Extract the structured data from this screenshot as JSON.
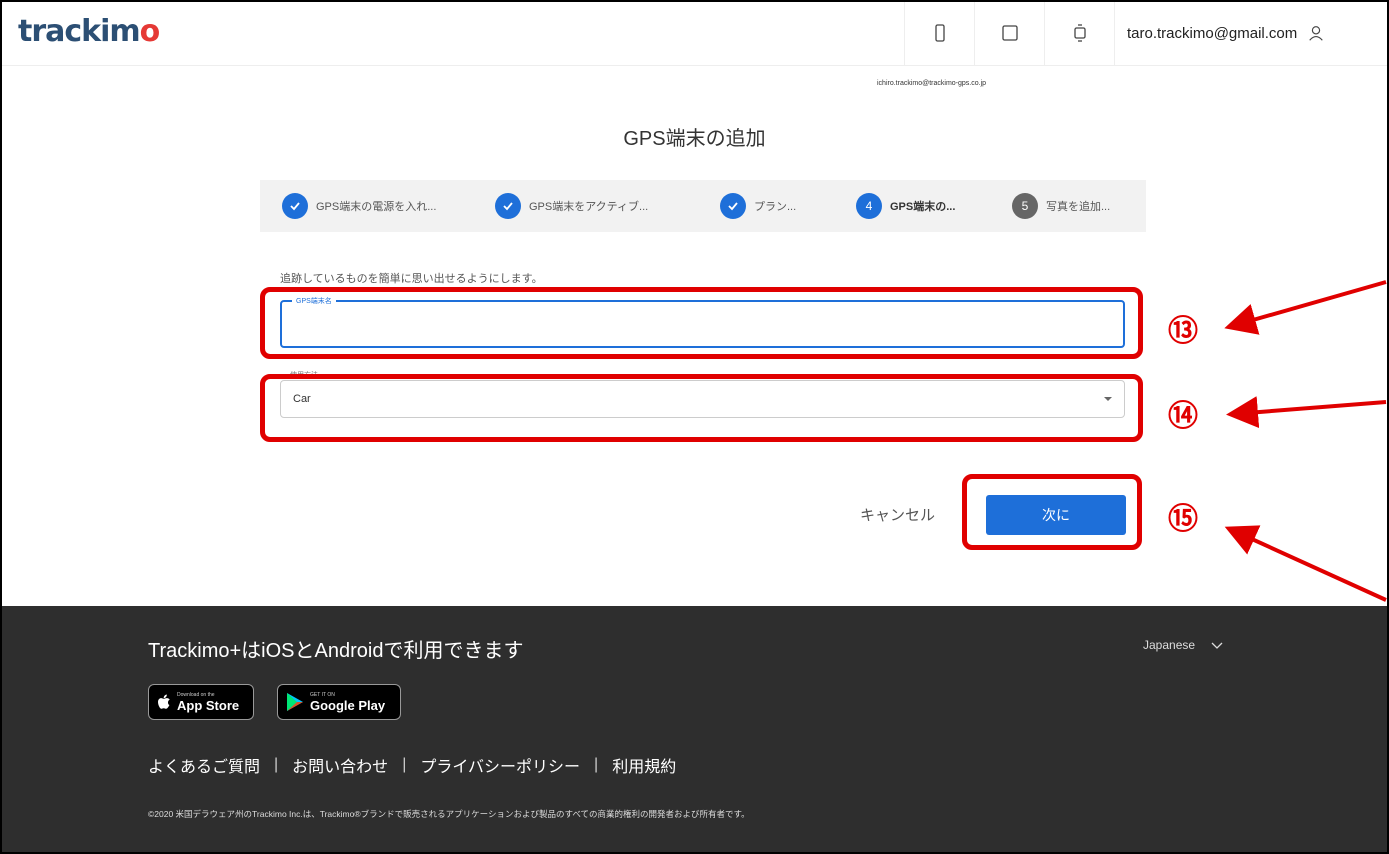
{
  "header": {
    "logo_main": "trackim",
    "logo_accent": "o",
    "user_email": "taro.trackimo@gmail.com",
    "sub_email": "ichiro.trackimo@trackimo-gps.co.jp",
    "icons": [
      "phone-icon",
      "tablet-icon",
      "watch-icon",
      "user-icon"
    ]
  },
  "page": {
    "title": "GPS端末の追加"
  },
  "stepper": {
    "steps": [
      {
        "label": "GPS端末の電源を入れ...",
        "state": "done"
      },
      {
        "label": "GPS端末をアクティブ...",
        "state": "done"
      },
      {
        "label": "プラン...",
        "state": "done"
      },
      {
        "label": "GPS端末の...",
        "number": "4",
        "state": "active"
      },
      {
        "label": "写真を追加...",
        "number": "5",
        "state": "pending"
      }
    ]
  },
  "form": {
    "hint": "追跡しているものを簡単に思い出せるようにします。",
    "name_label": "GPS端末名",
    "name_value": "",
    "type_label": "使用方法",
    "type_value": "Car",
    "cancel_label": "キャンセル",
    "next_label": "次に"
  },
  "annotations": {
    "n13": "⑬",
    "n14": "⑭",
    "n15": "⑮"
  },
  "footer": {
    "title": "Trackimo+はiOSとAndroidで利用できます",
    "language": "Japanese",
    "appstore_small": "Download on the",
    "appstore_big": "App Store",
    "googleplay_small": "GET IT ON",
    "googleplay_big": "Google Play",
    "links": [
      "よくあるご質問",
      "お問い合わせ",
      "プライバシーポリシー",
      "利用規約"
    ],
    "separator": "|",
    "copyright": "©2020 米国デラウェア州のTrackimo Inc.は、Trackimo®ブランドで販売されるアプリケーションおよび製品のすべての商業的権利の開発者および所有者です。"
  },
  "colors": {
    "accent": "#1e6fd9",
    "annotation": "#e00000",
    "footer_bg": "#2e2e2e",
    "logo": "#2c4f74"
  }
}
